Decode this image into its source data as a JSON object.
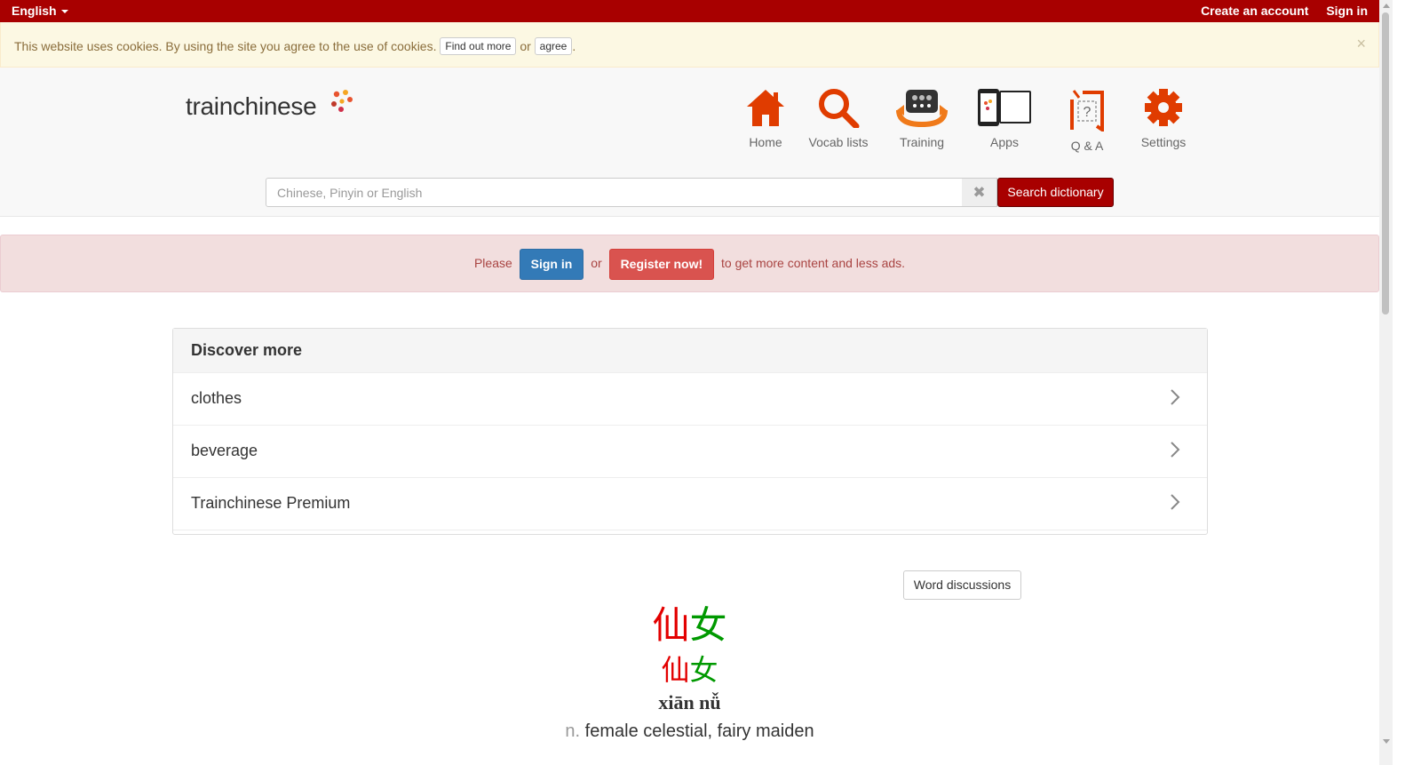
{
  "topbar": {
    "language": "English",
    "create_account": "Create an account",
    "sign_in": "Sign in"
  },
  "cookie": {
    "message": "This website uses cookies. By using the site you agree to the use of cookies.",
    "find_out_more": "Find out more",
    "or": "or",
    "agree": "agree",
    "period": ".",
    "close": "×"
  },
  "header": {
    "logo": "trainchinese",
    "nav": [
      {
        "label": "Home",
        "icon": "home-icon"
      },
      {
        "label": "Vocab lists",
        "icon": "magnifier-icon"
      },
      {
        "label": "Training",
        "icon": "training-icon"
      },
      {
        "label": "Apps",
        "icon": "devices-icon"
      },
      {
        "label": "Q & A",
        "icon": "question-icon"
      },
      {
        "label": "Settings",
        "icon": "gear-icon"
      }
    ]
  },
  "search": {
    "placeholder": "Chinese, Pinyin or English",
    "value": "",
    "clear": "✖",
    "button": "Search dictionary"
  },
  "banner": {
    "please": "Please",
    "sign_in": "Sign in",
    "or": "or",
    "register": "Register now!",
    "suffix": "to get more content and less ads."
  },
  "discover": {
    "title": "Discover more",
    "items": [
      {
        "label": "clothes"
      },
      {
        "label": "beverage"
      },
      {
        "label": "Trainchinese Premium"
      }
    ]
  },
  "word": {
    "discussions_button": "Word discussions",
    "char1": "仙",
    "char2": "女",
    "pinyin": "xiān nǚ",
    "pos": "n.",
    "meaning": "female celestial, fairy maiden"
  },
  "colors": {
    "brand_red": "#a80000",
    "tone_red": "#e30000",
    "tone_green": "#009900",
    "icon_orange": "#e03c00",
    "sign_in_blue": "#337ab7",
    "register_red": "#d9534f"
  }
}
